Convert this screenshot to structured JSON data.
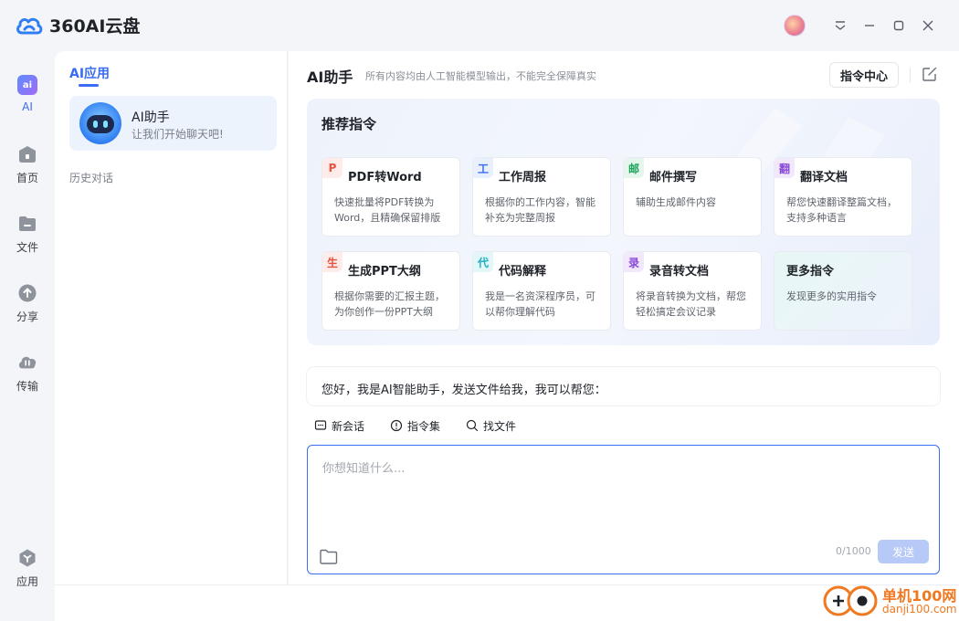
{
  "app": {
    "title": "360AI云盘"
  },
  "rail": {
    "items": [
      {
        "label": "AI",
        "icon": "ai-icon"
      },
      {
        "label": "首页",
        "icon": "home-icon"
      },
      {
        "label": "文件",
        "icon": "folder-icon"
      },
      {
        "label": "分享",
        "icon": "share-icon"
      },
      {
        "label": "传输",
        "icon": "transfer-icon"
      }
    ],
    "bottom_item": {
      "label": "应用",
      "icon": "apps-icon"
    }
  },
  "sidebar": {
    "tab_label": "AI应用",
    "assistant": {
      "name": "AI助手",
      "subtitle": "让我们开始聊天吧!"
    },
    "history_label": "历史对话"
  },
  "main": {
    "title": "AI助手",
    "note": "所有内容均由人工智能模型输出，不能完全保障真实",
    "command_center": "指令中心",
    "recommend_title": "推荐指令",
    "cards": [
      {
        "badge": "P",
        "badge_color": "#e8523f",
        "badge_bg": "#fdecea",
        "title": "PDF转Word",
        "desc": "快速批量将PDF转换为Word，且精确保留排版"
      },
      {
        "badge": "工",
        "badge_color": "#3a6cf4",
        "badge_bg": "#e8effd",
        "title": "工作周报",
        "desc": "根据你的工作内容，智能补充为完整周报"
      },
      {
        "badge": "邮",
        "badge_color": "#1aa35a",
        "badge_bg": "#e5f6ec",
        "title": "邮件撰写",
        "desc": "辅助生成邮件内容"
      },
      {
        "badge": "翻",
        "badge_color": "#8a4ad8",
        "badge_bg": "#f1e9fb",
        "title": "翻译文档",
        "desc": "帮您快速翻译整篇文档，支持多种语言"
      },
      {
        "badge": "生",
        "badge_color": "#e8523f",
        "badge_bg": "#fdecea",
        "title": "生成PPT大纲",
        "desc": "根据你需要的汇报主题，为你创作一份PPT大纲"
      },
      {
        "badge": "代",
        "badge_color": "#1bb0c4",
        "badge_bg": "#e3f6f8",
        "title": "代码解释",
        "desc": "我是一名资深程序员，可以帮你理解代码"
      },
      {
        "badge": "录",
        "badge_color": "#8a4ad8",
        "badge_bg": "#f1e9fb",
        "title": "录音转文档",
        "desc": "将录音转换为文档，帮您轻松搞定会议记录"
      },
      {
        "badge": "",
        "badge_color": "",
        "badge_bg": "",
        "title": "更多指令",
        "desc": "发现更多的实用指令"
      }
    ],
    "greeting": "您好，我是AI智能助手，发送文件给我，我可以帮您：",
    "tools": [
      {
        "label": "新会话",
        "icon": "chat-icon"
      },
      {
        "label": "指令集",
        "icon": "command-icon"
      },
      {
        "label": "找文件",
        "icon": "search-icon"
      }
    ],
    "input": {
      "placeholder": "你想知道什么...",
      "counter": "0/1000",
      "send_label": "发送"
    }
  },
  "watermark": {
    "line1": "单机100网",
    "line2": "danji100.com"
  }
}
